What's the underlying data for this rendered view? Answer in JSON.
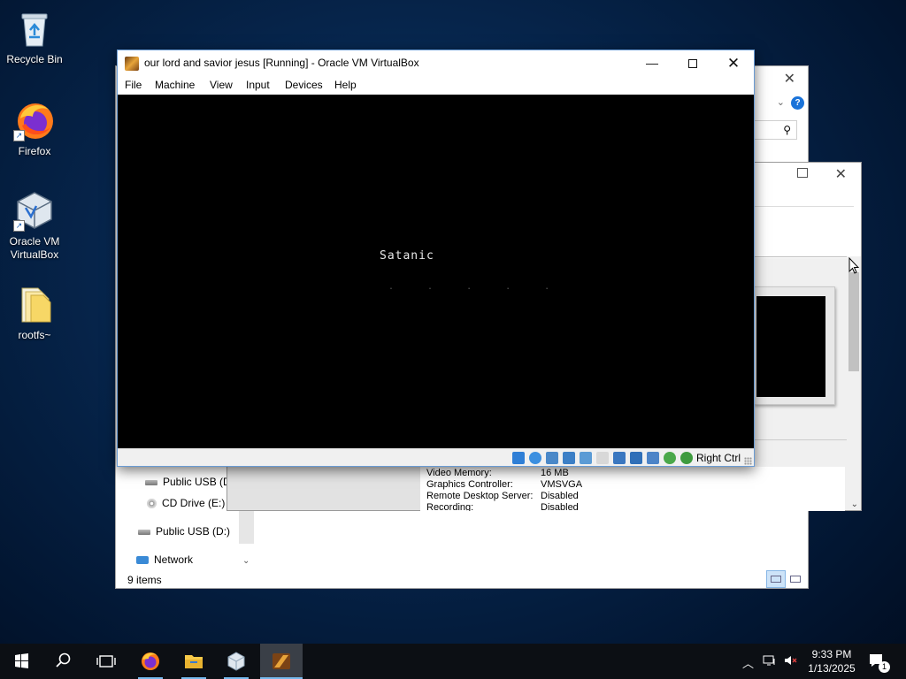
{
  "desktop": {
    "icons": [
      {
        "label": "Recycle Bin"
      },
      {
        "label": "Firefox"
      },
      {
        "label": "Oracle VM VirtualBox"
      },
      {
        "label": "rootfs~"
      }
    ]
  },
  "explorer": {
    "nav": {
      "usb_d_1": "Public USB (D:",
      "cd_drive": "CD Drive (E:) C",
      "usb_d_2": "Public USB (D:)",
      "network": "Network"
    },
    "status": "9 items"
  },
  "settings": {
    "details": [
      {
        "key": "Video Memory:",
        "value": "16 MB"
      },
      {
        "key": "Graphics Controller:",
        "value": "VMSVGA"
      },
      {
        "key": "Remote Desktop Server:",
        "value": "Disabled"
      },
      {
        "key": "Recording:",
        "value": "Disabled"
      }
    ]
  },
  "vm_window": {
    "title": "our lord and savior jesus [Running] - Oracle VM VirtualBox",
    "menu": [
      "File",
      "Machine",
      "View",
      "Input",
      "Devices",
      "Help"
    ],
    "screen_text": "Satanic",
    "screen_dots": ". . . . .",
    "host_key": "Right Ctrl",
    "status_icon_colors": [
      "#2f7fd6",
      "#3b8fe0",
      "#4a88c8",
      "#3c7fc6",
      "#5b9bd5",
      "#d8d8d8",
      "#3a77c0",
      "#2f6fb8",
      "#4c84c8",
      "#4aa84a",
      "#3e9b3e"
    ]
  },
  "taskbar": {
    "time": "9:33 PM",
    "date": "1/13/2025",
    "notification_count": "1",
    "apps": [
      "start-icon",
      "search-icon",
      "task-view-icon",
      "firefox-icon",
      "file-explorer-icon",
      "virtualbox-icon",
      "vm-instance-icon"
    ]
  }
}
